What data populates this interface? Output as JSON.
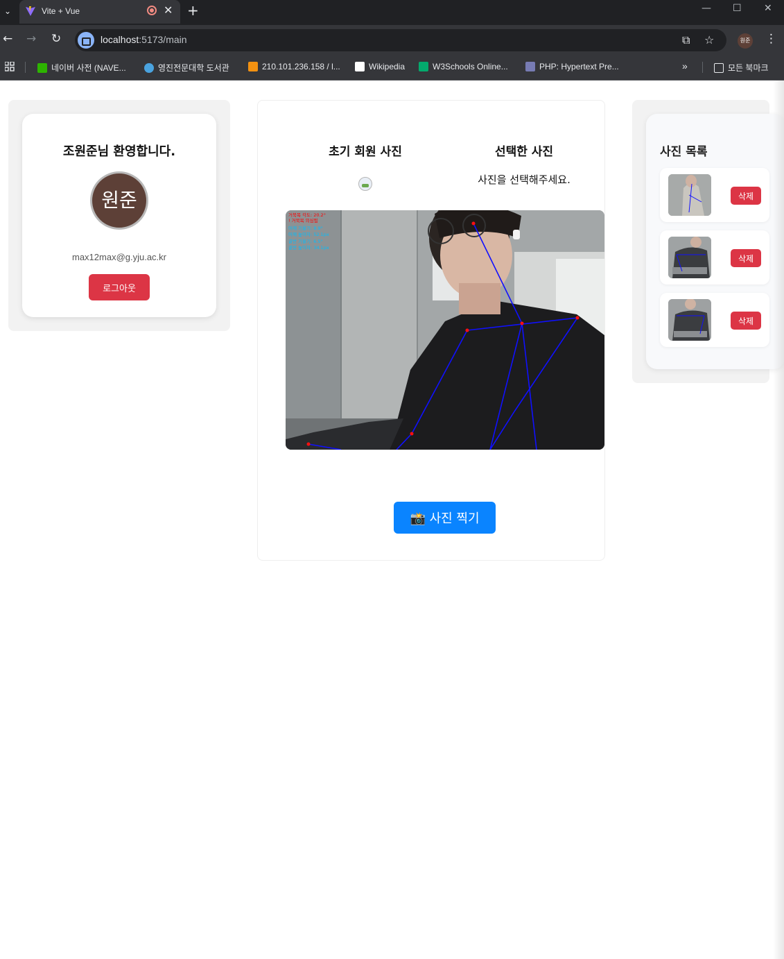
{
  "browser": {
    "tab_title": "Vite + Vue",
    "url_host": "localhost",
    "url_path": ":5173/main",
    "profile_initials": "원준",
    "bookmarks": [
      {
        "label": "네이버 사전 (NAVE...",
        "icon": "naver-dict-icon",
        "color": "#2db400"
      },
      {
        "label": "영진전문대학 도서관",
        "icon": "library-icon",
        "color": "#4aa3df"
      },
      {
        "label": "210.101.236.158 / l...",
        "icon": "phpmyadmin-icon",
        "color": "#f29111"
      },
      {
        "label": "Wikipedia",
        "icon": "wikipedia-icon",
        "color": "#ffffff"
      },
      {
        "label": "W3Schools Online...",
        "icon": "w3schools-icon",
        "color": "#04aa6d"
      },
      {
        "label": "PHP: Hypertext Pre...",
        "icon": "php-icon",
        "color": "#777bb3"
      }
    ],
    "all_bookmarks_label": "모든 북마크"
  },
  "profile": {
    "welcome": "조원준님 환영합니다.",
    "avatar_text": "원준",
    "email": "max12max@g.yju.ac.kr",
    "logout_label": "로그아웃",
    "avatar_color": "#5d4037"
  },
  "main": {
    "initial_photo_title": "초기 회원 사진",
    "selected_photo_title": "선택한 사진",
    "select_hint": "사진을 선택해주세요.",
    "overlay_lines": [
      "거북목 각도: 20.2°",
      "! 거북목 의심됨",
      "어깨 기울기: 8.9°",
      "어깨 높이차: 52.1px",
      "골반 기울기: 6.5°",
      "골반 높이차: 34.1px"
    ],
    "capture_label": "📸 사진 찍기",
    "accent": "#0a84ff"
  },
  "photo_list": {
    "title": "사진 목록",
    "items": [
      {
        "delete_label": "삭제"
      },
      {
        "delete_label": "삭제"
      },
      {
        "delete_label": "삭제"
      }
    ],
    "danger_color": "#dc3545"
  }
}
